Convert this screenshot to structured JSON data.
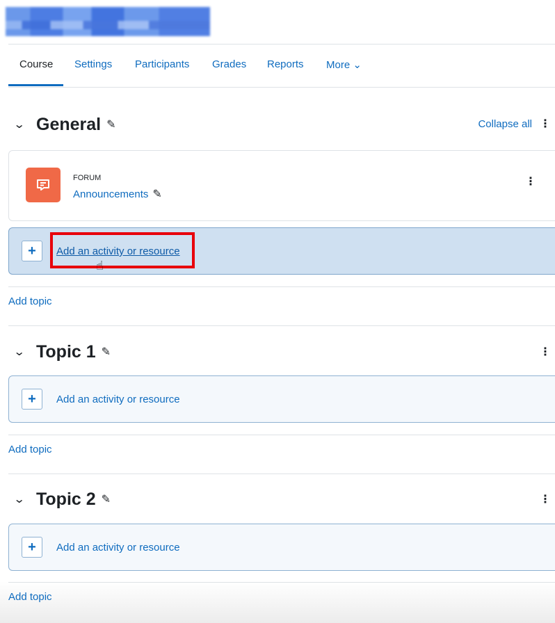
{
  "tabs": {
    "course": "Course",
    "settings": "Settings",
    "participants": "Participants",
    "grades": "Grades",
    "reports": "Reports",
    "more": "More ⌄"
  },
  "general": {
    "title": "General",
    "collapse_all": "Collapse all",
    "forum": {
      "type": "FORUM",
      "name": "Announcements"
    },
    "add_activity": "Add an activity or resource"
  },
  "add_topic": "Add topic",
  "topic1": {
    "title": "Topic 1",
    "add_activity": "Add an activity or resource"
  },
  "topic2": {
    "title": "Topic 2",
    "add_activity": "Add an activity or resource"
  },
  "icons": {
    "chevron": "chevron-down-icon",
    "edit": "pencil-icon",
    "menu": "kebab-menu-icon",
    "plus": "plus-icon",
    "forum": "forum-icon"
  },
  "colors": {
    "link": "#0f6cbf",
    "forum_icon_bg": "#f06947",
    "highlight_frame": "#e8000b",
    "add_box_bg": "#f4f8fc",
    "add_box_hover_bg": "#cfe0f1"
  }
}
